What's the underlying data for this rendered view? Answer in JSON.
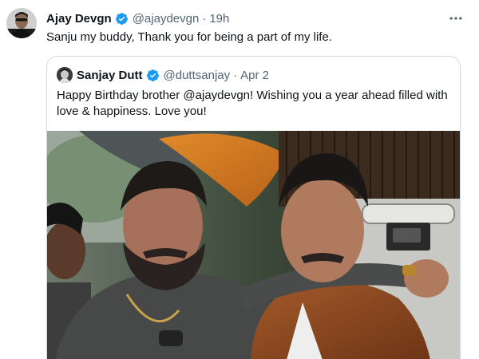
{
  "tweet": {
    "author_name": "Ajay Devgn",
    "author_handle": "@ajaydevgn",
    "separator": "·",
    "time": "19h",
    "text": "Sanju my buddy, Thank you for being a part of my life.",
    "verified_icon": "verified-badge-icon",
    "more_icon": "more-options-icon"
  },
  "quote": {
    "author_name": "Sanjay Dutt",
    "author_handle": "@duttsanjay",
    "separator": "·",
    "time": "Apr 2",
    "text": "Happy Birthday brother @ajaydevgn! Wishing you a year ahead filled with love & happiness. Love you!",
    "verified_icon": "verified-badge-icon"
  },
  "colors": {
    "accent": "#1d9bf0",
    "text_primary": "#0f1419",
    "text_secondary": "#536471",
    "border": "#cfd9de"
  }
}
